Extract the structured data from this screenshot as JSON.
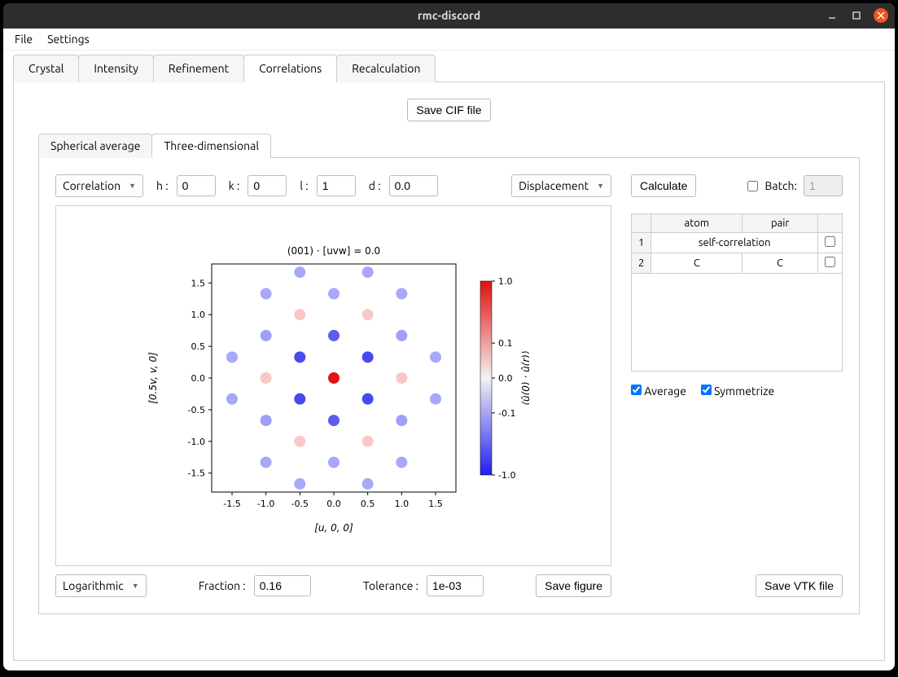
{
  "title": "rmc-discord",
  "menu": {
    "file": "File",
    "settings": "Settings"
  },
  "tabs": [
    "Crystal",
    "Intensity",
    "Refinement",
    "Correlations",
    "Recalculation"
  ],
  "active_tab": "Correlations",
  "save_cif": "Save CIF file",
  "subtabs": [
    "Spherical average",
    "Three-dimensional"
  ],
  "active_subtab": "Three-dimensional",
  "corr_dropdown": "Correlation",
  "hkl": {
    "h_lbl": "h :",
    "h": "0",
    "k_lbl": "k :",
    "k": "0",
    "l_lbl": "l :",
    "l": "1",
    "d_lbl": "d :",
    "d": "0.0"
  },
  "disp_dropdown": "Displacement",
  "calc": "Calculate",
  "batch_lbl": "Batch:",
  "batch_val": "1",
  "table": {
    "headers": [
      "atom",
      "pair",
      ""
    ],
    "rows": [
      {
        "n": "1",
        "atom": "self-correlation",
        "pair": "",
        "span": true
      },
      {
        "n": "2",
        "atom": "C",
        "pair": "C",
        "span": false
      }
    ]
  },
  "avg_lbl": "Average",
  "sym_lbl": "Symmetrize",
  "log_dropdown": "Logarithmic",
  "fraction_lbl": "Fraction :",
  "fraction": "0.16",
  "tol_lbl": "Tolerance :",
  "tol": "1e-03",
  "save_fig": "Save figure",
  "save_vtk": "Save VTK file",
  "chart_data": {
    "type": "scatter",
    "title": "(001) · [uvw] = 0.0",
    "xlabel": "[u, 0, 0]",
    "ylabel": "[0.5v, v, 0]",
    "colorbar_label": "⟨û(0) · û(r)⟩",
    "xlim": [
      -1.8,
      1.8
    ],
    "ylim": [
      -1.8,
      1.8
    ],
    "clim": [
      -1.0,
      1.0
    ],
    "xticks": [
      -1.5,
      -1.0,
      -0.5,
      0.0,
      0.5,
      1.0,
      1.5
    ],
    "yticks": [
      -1.5,
      -1.0,
      -0.5,
      0.0,
      0.5,
      1.0,
      1.5
    ],
    "cticks": [
      -1.0,
      -0.1,
      0.0,
      0.1,
      1.0
    ],
    "points": [
      {
        "x": -0.5,
        "y": 1.67,
        "v": -0.3
      },
      {
        "x": 0.5,
        "y": 1.67,
        "v": -0.3
      },
      {
        "x": -1.0,
        "y": 1.33,
        "v": -0.3
      },
      {
        "x": 0.0,
        "y": 1.33,
        "v": -0.3
      },
      {
        "x": 1.0,
        "y": 1.33,
        "v": -0.3
      },
      {
        "x": -0.5,
        "y": 1.0,
        "v": 0.15
      },
      {
        "x": 0.5,
        "y": 1.0,
        "v": 0.15
      },
      {
        "x": -1.0,
        "y": 0.67,
        "v": -0.35
      },
      {
        "x": 0.0,
        "y": 0.67,
        "v": -0.7
      },
      {
        "x": 1.0,
        "y": 0.67,
        "v": -0.35
      },
      {
        "x": -1.5,
        "y": 0.33,
        "v": -0.3
      },
      {
        "x": -0.5,
        "y": 0.33,
        "v": -0.8
      },
      {
        "x": 0.5,
        "y": 0.33,
        "v": -0.8
      },
      {
        "x": 1.5,
        "y": 0.33,
        "v": -0.3
      },
      {
        "x": -1.0,
        "y": 0.0,
        "v": 0.15
      },
      {
        "x": 0.0,
        "y": 0.0,
        "v": 1.0
      },
      {
        "x": 1.0,
        "y": 0.0,
        "v": 0.15
      },
      {
        "x": -1.5,
        "y": -0.33,
        "v": -0.3
      },
      {
        "x": -0.5,
        "y": -0.33,
        "v": -0.8
      },
      {
        "x": 0.5,
        "y": -0.33,
        "v": -0.8
      },
      {
        "x": 1.5,
        "y": -0.33,
        "v": -0.3
      },
      {
        "x": -1.0,
        "y": -0.67,
        "v": -0.35
      },
      {
        "x": 0.0,
        "y": -0.67,
        "v": -0.7
      },
      {
        "x": 1.0,
        "y": -0.67,
        "v": -0.35
      },
      {
        "x": -0.5,
        "y": -1.0,
        "v": 0.15
      },
      {
        "x": 0.5,
        "y": -1.0,
        "v": 0.15
      },
      {
        "x": -1.0,
        "y": -1.33,
        "v": -0.3
      },
      {
        "x": 0.0,
        "y": -1.33,
        "v": -0.3
      },
      {
        "x": 1.0,
        "y": -1.33,
        "v": -0.3
      },
      {
        "x": -0.5,
        "y": -1.67,
        "v": -0.3
      },
      {
        "x": 0.5,
        "y": -1.67,
        "v": -0.3
      }
    ]
  }
}
